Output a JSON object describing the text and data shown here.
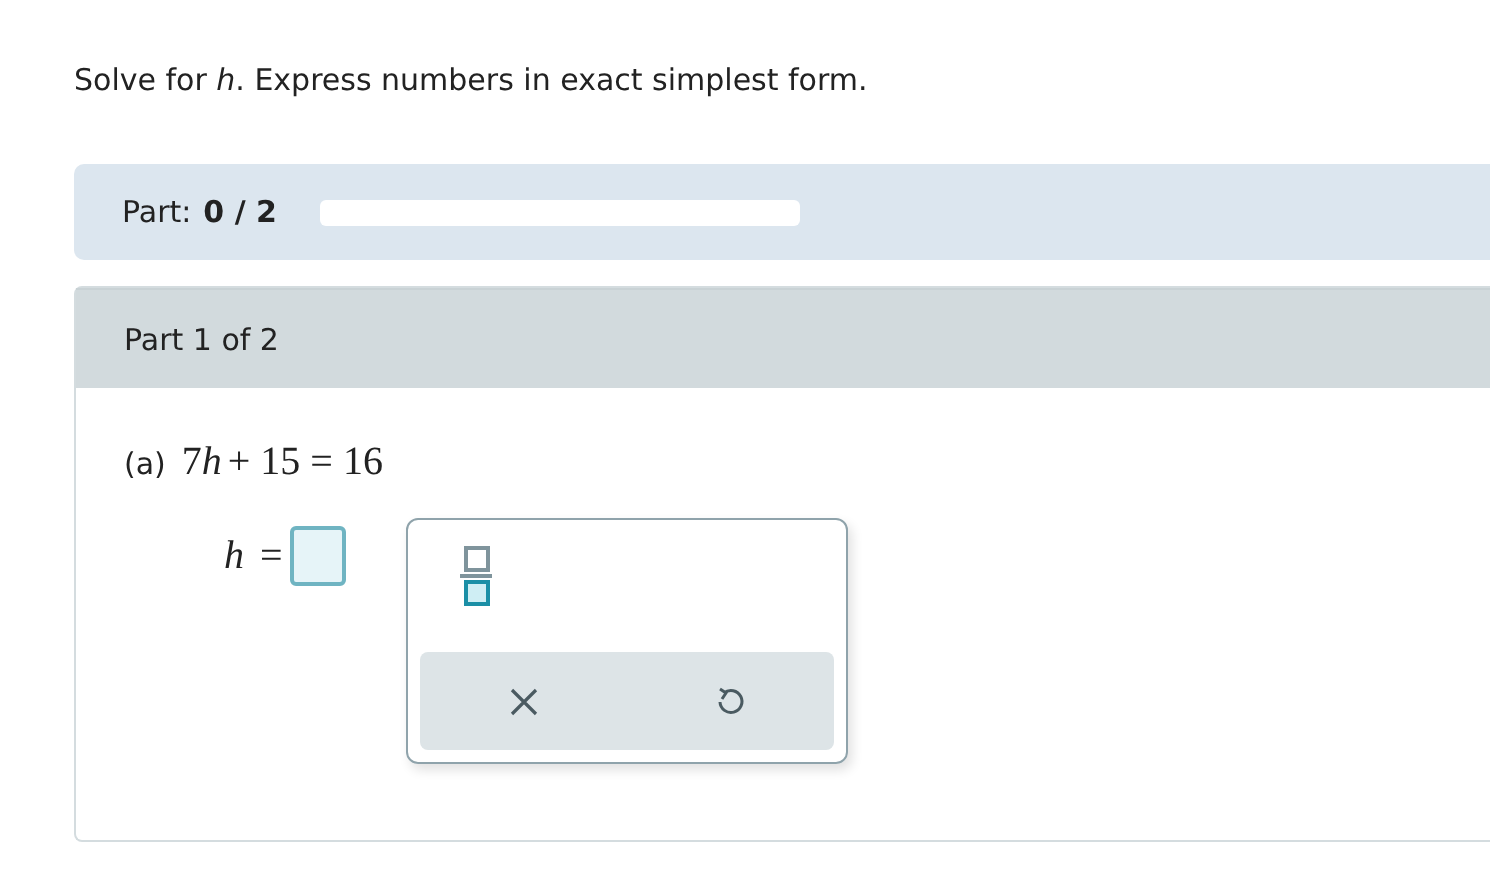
{
  "instruction": "Solve for *h*. Express numbers in exact simplest form.",
  "progress": {
    "label": "Part:",
    "value": "0 / 2",
    "level": 0
  },
  "part": {
    "title": "Part 1 of 2",
    "question_label": "(a)",
    "equation": {
      "coefficient": "7",
      "variable": "h",
      "rest": "+ 15 = 16"
    },
    "answer_label": {
      "variable": "h",
      "sign": "="
    }
  }
}
